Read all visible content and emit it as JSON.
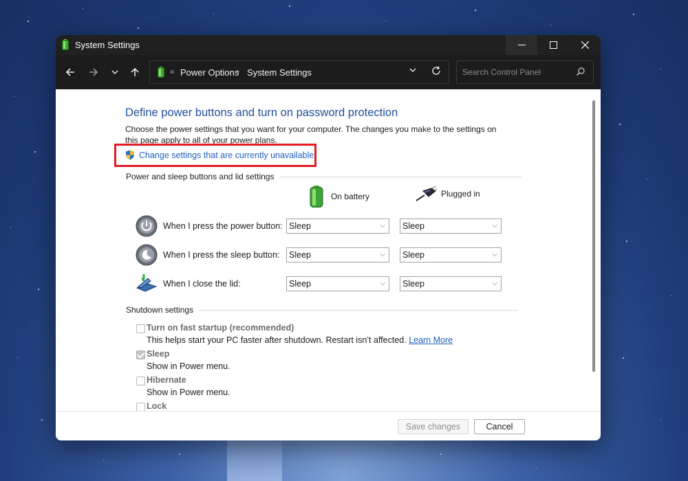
{
  "window": {
    "title": "System Settings",
    "controls": {
      "minimize": "minimize-icon",
      "maximize": "maximize-icon",
      "close": "close-icon"
    }
  },
  "navbar": {
    "breadcrumb_prefix": "«",
    "breadcrumb": [
      "Power Options",
      "System Settings"
    ],
    "breadcrumb_separator": "›",
    "search_placeholder": "Search Control Panel"
  },
  "page": {
    "heading": "Define power buttons and turn on password protection",
    "intro": "Choose the power settings that you want for your computer. The changes you make to the settings on this page apply to all of your power plans.",
    "change_link": "Change settings that are currently unavailable"
  },
  "power_section": {
    "title": "Power and sleep buttons and lid settings",
    "col_battery": "On battery",
    "col_plugged": "Plugged in",
    "rows": [
      {
        "label": "When I press the power button:",
        "battery": "Sleep",
        "plugged": "Sleep",
        "icon": "power-button-icon"
      },
      {
        "label": "When I press the sleep button:",
        "battery": "Sleep",
        "plugged": "Sleep",
        "icon": "sleep-button-icon"
      },
      {
        "label": "When I close the lid:",
        "battery": "Sleep",
        "plugged": "Sleep",
        "icon": "laptop-lid-icon"
      }
    ]
  },
  "shutdown_section": {
    "title": "Shutdown settings",
    "items": [
      {
        "title": "Turn on fast startup (recommended)",
        "desc": "This helps start your PC faster after shutdown. Restart isn’t affected.",
        "link": "Learn More",
        "checked": false
      },
      {
        "title": "Sleep",
        "desc": "Show in Power menu.",
        "checked": true
      },
      {
        "title": "Hibernate",
        "desc": "Show in Power menu.",
        "checked": false
      },
      {
        "title": "Lock",
        "checked": false
      }
    ]
  },
  "footer": {
    "save": "Save changes",
    "cancel": "Cancel"
  },
  "colors": {
    "link": "#1f5fbf",
    "heading": "#1e4f9b",
    "highlight": "#e31b23",
    "titlebar": "#202020"
  }
}
